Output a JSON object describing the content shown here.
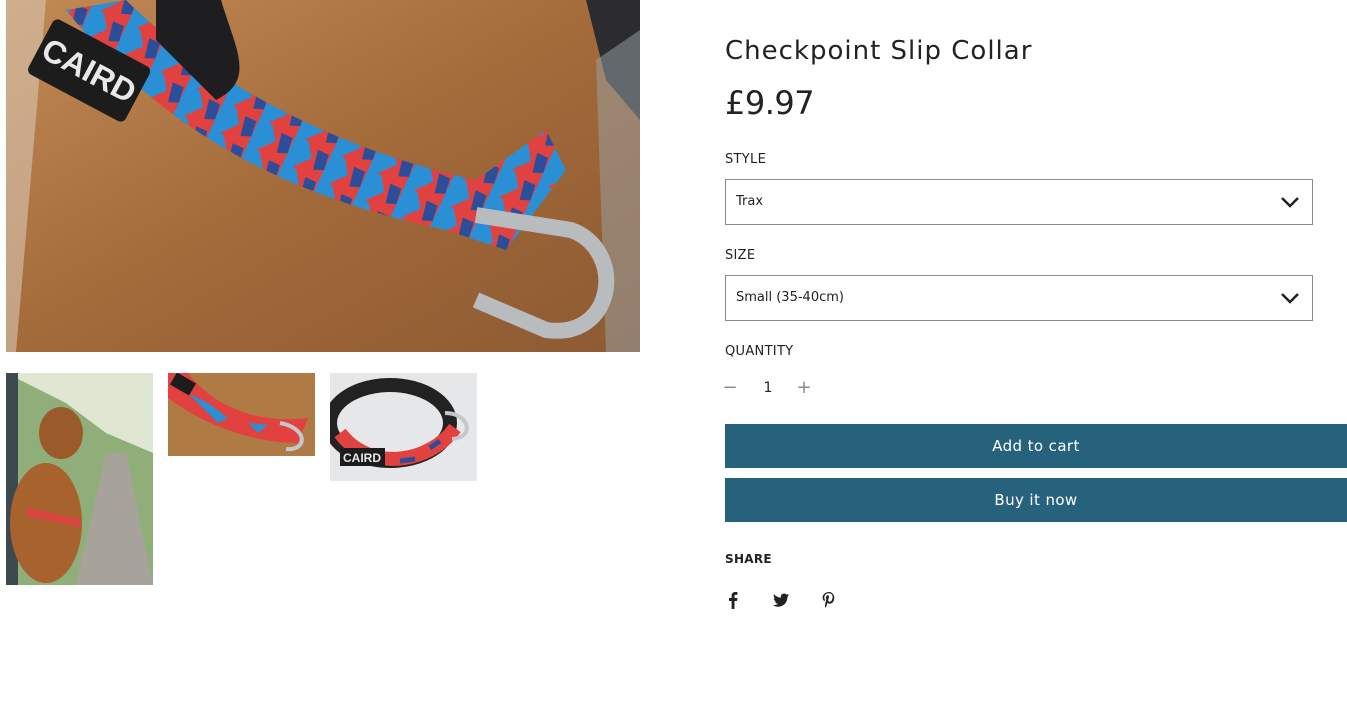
{
  "gallery": {
    "main_logo_text": "CAIRD",
    "thumb_logo_text": "CAIRD",
    "thumbnails": [
      {
        "icon": "dog-on-path-photo"
      },
      {
        "icon": "collar-on-dog-closeup-photo"
      },
      {
        "icon": "collar-product-photo"
      }
    ]
  },
  "product": {
    "title": "Checkpoint Slip Collar",
    "price": "£9.97"
  },
  "options": {
    "style_label": "STYLE",
    "style_value": "Trax",
    "size_label": "SIZE",
    "size_value": "Small (35-40cm)",
    "quantity_label": "QUANTITY",
    "quantity_value": "1",
    "minus": "−",
    "plus": "+"
  },
  "actions": {
    "add_to_cart": "Add to cart",
    "buy_now": "Buy it now"
  },
  "share": {
    "label": "SHARE",
    "icons": [
      "facebook-icon",
      "twitter-icon",
      "pinterest-icon"
    ]
  },
  "colors": {
    "button": "#27627d",
    "collar_red": "#e2423f",
    "collar_blue": "#2a8fd4"
  }
}
